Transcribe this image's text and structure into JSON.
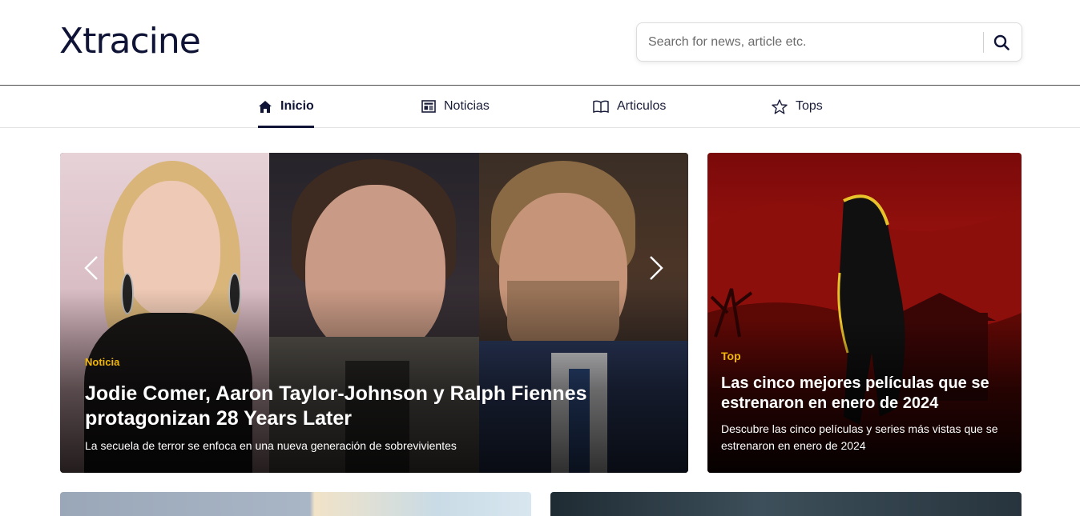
{
  "header": {
    "logo": "Xtracine",
    "search": {
      "placeholder": "Search for news, article etc.",
      "icon": "search-icon"
    }
  },
  "nav": {
    "items": [
      {
        "label": "Inicio",
        "icon": "home-icon",
        "active": true
      },
      {
        "label": "Noticias",
        "icon": "newspaper-icon",
        "active": false
      },
      {
        "label": "Articulos",
        "icon": "book-icon",
        "active": false
      },
      {
        "label": "Tops",
        "icon": "star-icon",
        "active": false
      }
    ]
  },
  "hero": {
    "tag": "Noticia",
    "title_line1": "Jodie Comer, Aaron Taylor-Johnson y Ralph Fiennes",
    "title_line2": "protagonizan 28 Years Later",
    "subtitle": "La secuela de terror se enfoca en una nueva generación de sobrevivientes",
    "prev_icon": "chevron-left-icon",
    "next_icon": "chevron-right-icon"
  },
  "side": {
    "tag": "Top",
    "title_line1": "Las cinco mejores películas que se",
    "title_line2": "estrenaron en enero de 2024",
    "subtitle_line1": "Descubre las cinco películas y series más vistas que se",
    "subtitle_line2": "estrenaron en enero de 2024"
  },
  "colors": {
    "brand": "#0f1437",
    "accent": "#f2b705"
  }
}
